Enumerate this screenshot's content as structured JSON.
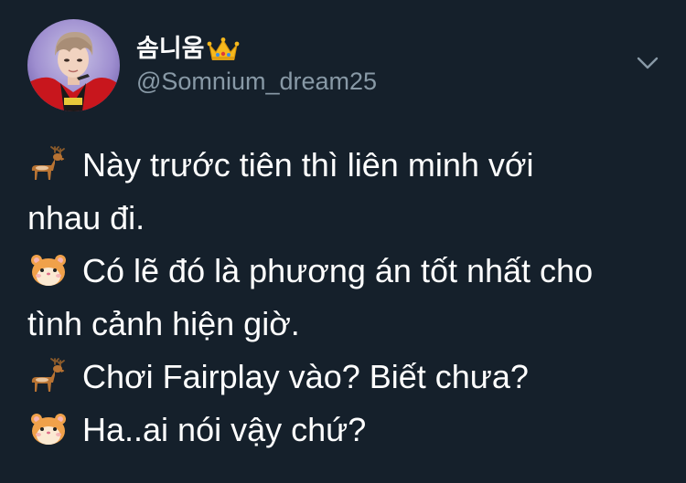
{
  "tweet": {
    "display_name": "솜니움",
    "handle": "@Somnium_dream25",
    "lines": [
      {
        "emoji": "deer-icon",
        "text": "Này trước tiên thì liên minh với"
      },
      {
        "emoji": "",
        "text": "nhau đi."
      },
      {
        "emoji": "hamster-icon",
        "text": "Có lẽ đó là phương án tốt nhất cho"
      },
      {
        "emoji": "",
        "text": "tình cảnh hiện giờ."
      },
      {
        "emoji": "deer-icon",
        "text": "Chơi Fairplay vào? Biết chưa?"
      },
      {
        "emoji": "hamster-icon",
        "text": "Ha..ai nói vậy chứ?"
      }
    ]
  },
  "icons": {
    "name_badge": "crown-icon",
    "menu": "chevron-down-icon"
  },
  "colors": {
    "background": "#15202b",
    "primary_text": "#ffffff",
    "secondary_text": "#8899a6"
  }
}
